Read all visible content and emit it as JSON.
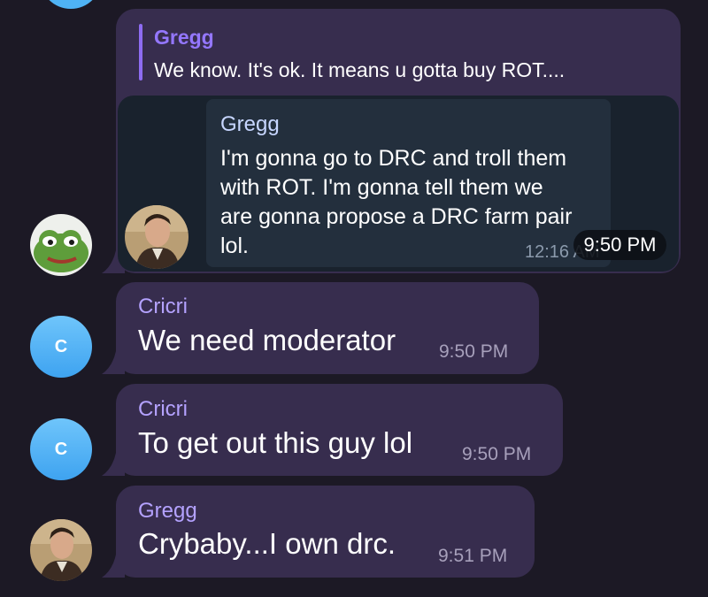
{
  "messages": [
    {
      "quote_sender": "Gregg",
      "quote_text": "We know. It's ok. It means u gotta buy ROT....",
      "forward": {
        "sender": "Gregg",
        "lines": [
          "I'm gonna go to DRC and troll them",
          "with ROT. I'm gonna tell them we",
          "are gonna propose a DRC farm pair",
          "lol."
        ],
        "time": "12:16 AM"
      },
      "time": "9:50 PM",
      "avatar_icon": "pepe-frog-avatar"
    },
    {
      "sender": "Cricri",
      "text": "We need moderator",
      "time": "9:50 PM",
      "avatar_letter": "C"
    },
    {
      "sender": "Cricri",
      "text": "To get out this guy lol",
      "time": "9:50 PM",
      "avatar_letter": "C"
    },
    {
      "sender": "Gregg",
      "text": "Crybaby...I own drc.",
      "time": "9:51 PM",
      "avatar_icon": "portrait-avatar"
    }
  ],
  "colors": {
    "background": "#1c1925",
    "bubble": "#372d4e",
    "sender_name": "#b4a2ff",
    "avatar_letter_bg": "#4fb3f5"
  }
}
